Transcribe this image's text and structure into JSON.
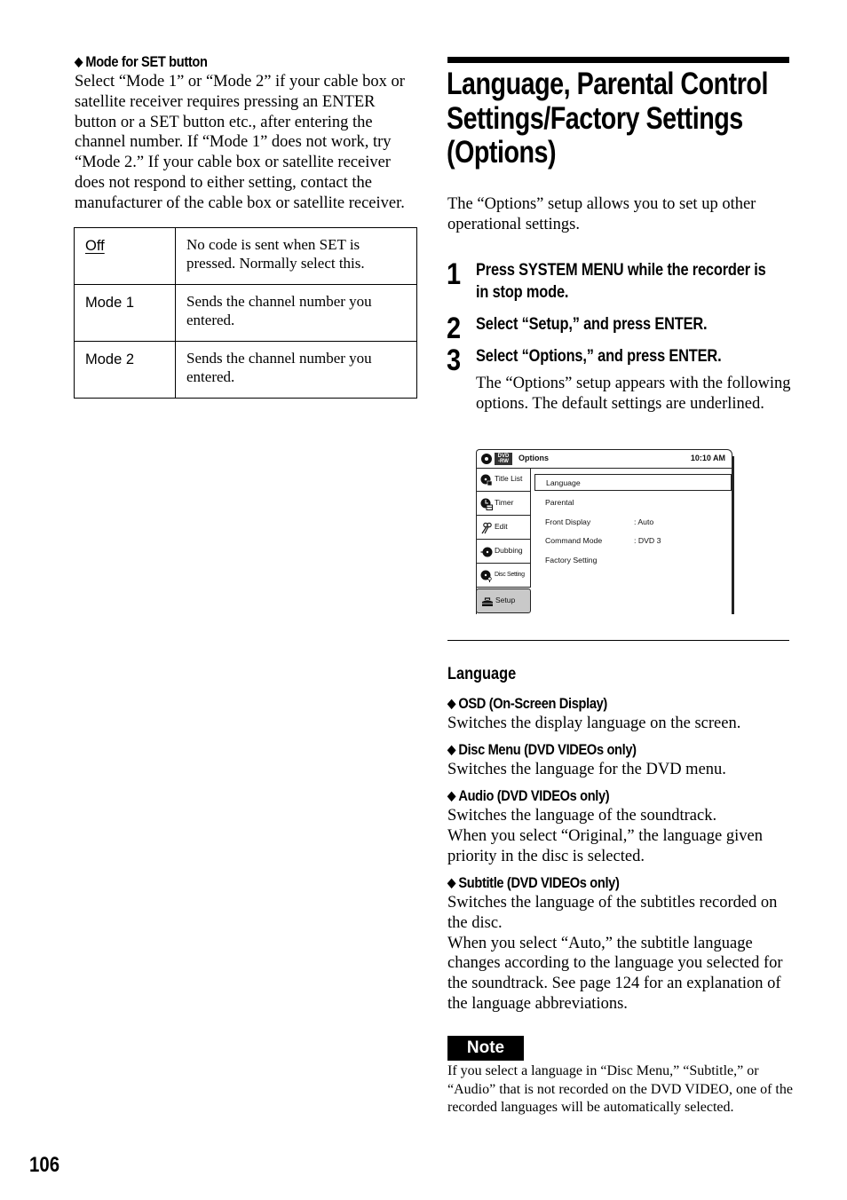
{
  "left_column": {
    "heading": "Mode for SET button",
    "paragraph": "Select “Mode 1” or “Mode 2” if your cable box or satellite receiver requires pressing an ENTER button or a SET button etc., after entering the channel number. If “Mode 1” does not work, try “Mode 2.” If your cable box or satellite receiver does not respond to either setting, contact the manufacturer of the cable box or satellite receiver.",
    "table": [
      {
        "option": "Off",
        "description": "No code is sent when SET is pressed. Normally select this.",
        "default": true
      },
      {
        "option": "Mode 1",
        "description": "Sends the channel number you entered.",
        "default": false
      },
      {
        "option": "Mode 2",
        "description": "Sends the channel number you entered.",
        "default": false
      }
    ]
  },
  "section": {
    "title": "Language, Parental Control Settings/Factory Settings (Options)",
    "title_lines": [
      "Language, Parental Control",
      "Settings/Factory Settings",
      "(Options)"
    ],
    "intro": "The “Options” setup allows you to set up other operational settings.",
    "steps": [
      {
        "number": "1",
        "lines": [
          "Press SYSTEM MENU while the recorder is",
          "in stop mode."
        ]
      },
      {
        "number": "2",
        "lines": [
          "Select “Setup,” and press ENTER."
        ]
      },
      {
        "number": "3",
        "lines": [
          "Select “Options,” and press ENTER."
        ]
      }
    ],
    "step3_description": "The “Options” setup appears with the following options. The default settings are underlined."
  },
  "osd": {
    "badge_top": "DVD",
    "badge_bottom": "-RW",
    "title": "Options",
    "time": "10:10 AM",
    "sidebar": [
      {
        "label": "Title List",
        "icon": "title-list-icon",
        "active": false
      },
      {
        "label": "Timer",
        "icon": "timer-icon",
        "active": false
      },
      {
        "label": "Edit",
        "icon": "edit-scissors-icon",
        "active": false
      },
      {
        "label": "Dubbing",
        "icon": "dubbing-icon",
        "active": false
      },
      {
        "label": "Disc Setting",
        "icon": "disc-setting-icon",
        "active": false
      },
      {
        "label": "Setup",
        "icon": "setup-toolbox-icon",
        "active": true
      }
    ],
    "menu": [
      {
        "label": "Language",
        "value": "",
        "selected": true
      },
      {
        "label": "Parental",
        "value": "",
        "selected": false
      },
      {
        "label": "Front Display",
        "value": ":  Auto",
        "selected": false
      },
      {
        "label": "Command Mode",
        "value": ":  DVD 3",
        "selected": false
      },
      {
        "label": "Factory Setting",
        "value": "",
        "selected": false
      }
    ]
  },
  "language_section": {
    "heading": "Language",
    "options": [
      {
        "heading": "OSD (On-Screen Display)",
        "lines": [
          "Switches the display language on the screen."
        ]
      },
      {
        "heading": "Disc Menu (DVD VIDEOs only)",
        "lines": [
          "Switches the language for the DVD menu."
        ]
      },
      {
        "heading": "Audio (DVD VIDEOs only)",
        "lines": [
          "Switches the language of the soundtrack.",
          "When you select “Original,” the language given priority in the disc is selected."
        ]
      },
      {
        "heading": "Subtitle (DVD VIDEOs only)",
        "lines": [
          "Switches the language of the subtitles recorded on the disc.",
          "When you select “Auto,” the subtitle language changes according to the language you selected for the soundtrack. See page 124 for an explanation of the language abbreviations."
        ]
      }
    ]
  },
  "note": {
    "label": "Note",
    "text": "If you select a language in “Disc Menu,” “Subtitle,” or “Audio” that is not recorded on the DVD VIDEO, one of the recorded languages will be automatically selected."
  },
  "page_number": "106"
}
